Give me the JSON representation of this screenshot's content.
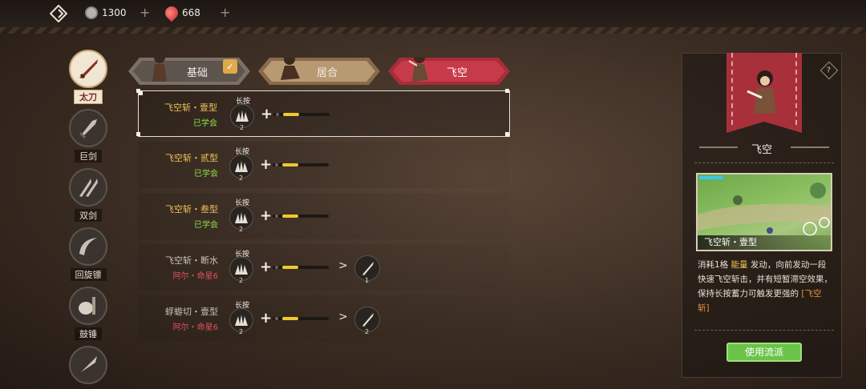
{
  "topbar": {
    "currency1": {
      "icon": "coin-icon",
      "value": "1300"
    },
    "currency2": {
      "icon": "crystal-icon",
      "value": "668"
    }
  },
  "weapons": [
    {
      "label": "太刀",
      "icon": "katana-icon",
      "active": true
    },
    {
      "label": "巨剑",
      "icon": "greatsword-icon",
      "active": false
    },
    {
      "label": "双剑",
      "icon": "dual-blades-icon",
      "active": false
    },
    {
      "label": "回旋镖",
      "icon": "boomerang-icon",
      "active": false
    },
    {
      "label": "鼓锤",
      "icon": "drum-hammer-icon",
      "active": false
    }
  ],
  "tabs": [
    {
      "label": "基础",
      "state": "equipped"
    },
    {
      "label": "居合",
      "state": "normal"
    },
    {
      "label": "飞空",
      "state": "selected"
    }
  ],
  "skills": [
    {
      "name": "飞空斩・壹型",
      "status": "已学会",
      "learned": true,
      "input_label": "长按",
      "input_count": "2",
      "energy": 0.4,
      "extra": null
    },
    {
      "name": "飞空斩・贰型",
      "status": "已学会",
      "learned": true,
      "input_label": "长按",
      "input_count": "2",
      "energy": 0.4,
      "extra": null
    },
    {
      "name": "飞空斩・叁型",
      "status": "已学会",
      "learned": true,
      "input_label": "长按",
      "input_count": "2",
      "energy": 0.4,
      "extra": null
    },
    {
      "name": "飞空斩・断水",
      "status": "阿尔・命星6",
      "learned": false,
      "input_label": "长按",
      "input_count": "2",
      "energy": 0.4,
      "extra": {
        "icon": "blade-icon",
        "count": "1"
      }
    },
    {
      "name": "蜉蝣切・壹型",
      "status": "阿尔・命星6",
      "learned": false,
      "input_label": "长按",
      "input_count": "2",
      "energy": 0.4,
      "extra": {
        "icon": "grass-icon",
        "count": "2"
      }
    }
  ],
  "panel": {
    "style_name": "飞空",
    "preview_caption": "飞空斩・壹型",
    "desc_pre": "消耗1格",
    "desc_hl": "能量",
    "desc_mid": "发动，向前发动一段快速飞空斩击，并有短暂滞空效果，保持长按蓄力可触发更强的",
    "desc_hl2": "[飞空斩]",
    "use_button": "使用流派",
    "help_icon": "?"
  },
  "colors": {
    "accent_red": "#a82c3a",
    "learned_green": "#8ee04a",
    "locked_red": "#e0525e",
    "gold": "#f0c25a",
    "button_green": "#6ac44a"
  }
}
